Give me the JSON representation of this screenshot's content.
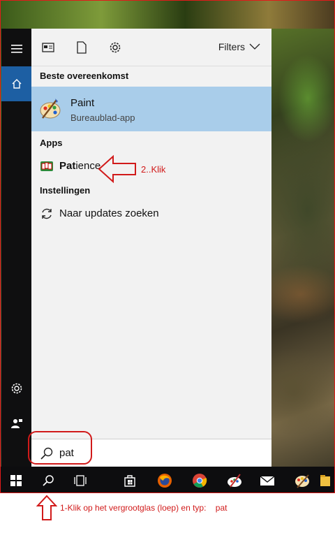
{
  "panel": {
    "filters_label": "Filters",
    "best_match_heading": "Beste overeenkomst",
    "best_match": {
      "name": "Paint",
      "type": "Bureaublad-app"
    },
    "apps_heading": "Apps",
    "apps": [
      {
        "bold_part": "Pat",
        "rest": "ience"
      }
    ],
    "settings_heading": "Instellingen",
    "settings": [
      {
        "label": "Naar updates zoeken"
      }
    ]
  },
  "search": {
    "value": "pat"
  },
  "annotations": {
    "step2": "2..Klik",
    "step1": "1-Klik op het vergrootglas (loep) en typ:    pat"
  },
  "colors": {
    "accent": "#1d5fa3",
    "highlight": "#a9cdea",
    "annotation": "#d11a1a"
  },
  "icons": {
    "rail": [
      "hamburger-menu-icon",
      "home-icon",
      "settings-gear-icon",
      "user-feedback-icon"
    ],
    "panel_top": [
      "documents-view-icon",
      "document-icon",
      "settings-gear-icon",
      "chevron-down-icon"
    ],
    "taskbar": [
      "windows-start-icon",
      "search-icon",
      "task-view-icon",
      "store-icon",
      "firefox-icon",
      "chrome-icon",
      "paint-app-icon",
      "mail-icon",
      "paint-palette-icon",
      "file-explorer-icon"
    ]
  }
}
